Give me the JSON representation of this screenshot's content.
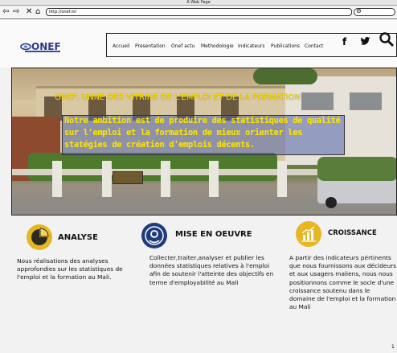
{
  "window": {
    "title": "A Web Page"
  },
  "browser": {
    "back_icon": "back-arrow-icon",
    "forward_icon": "forward-arrow-icon",
    "close_icon": "close-icon",
    "home_icon": "home-icon",
    "url": "http://onef.ml",
    "search_icon": "search-icon"
  },
  "header": {
    "logo": "ONEF",
    "nav": [
      "Accueil",
      "Presentation",
      "Onef actu",
      "Methodologie",
      "Indicateurs",
      "Publications",
      "Contact"
    ],
    "social": {
      "facebook": "f",
      "twitter": "twitter-icon"
    }
  },
  "hero": {
    "title": "ONEF, UNNE DES VITRINE DE L'EMPLOI ET DE LA FORMATION",
    "text": "Notre ambition est de produire des statistiques de qualité sur l'emploi et la formation de mieux orienter les statégies de création d'emplois décents.",
    "title_color": "#ffe600"
  },
  "features": [
    {
      "title": "ANALYSE",
      "icon": "pie-chart-icon",
      "text": "Nous réalisations des analyses approfondies sur les statistiques de l'emploi et la formation au Mali."
    },
    {
      "title": "MISE EN OEUVRE",
      "icon": "settings-shield-icon",
      "text": "Collecter,traiter,analyser et publier les données statistiques relatives à l'emploi afin de soutenir l'atteinte des objectifs en terme d'employabilité au Mali"
    },
    {
      "title": "CROISSANCE",
      "icon": "bar-growth-icon",
      "text": "A partir des indicateurs pértinents que nous fournissons aux décideurs et aux usagers maliens, nous nous positionnons comme le socle d'une croissance soutenu dans le domaine de l'emploi et la formation au Mali"
    }
  ]
}
